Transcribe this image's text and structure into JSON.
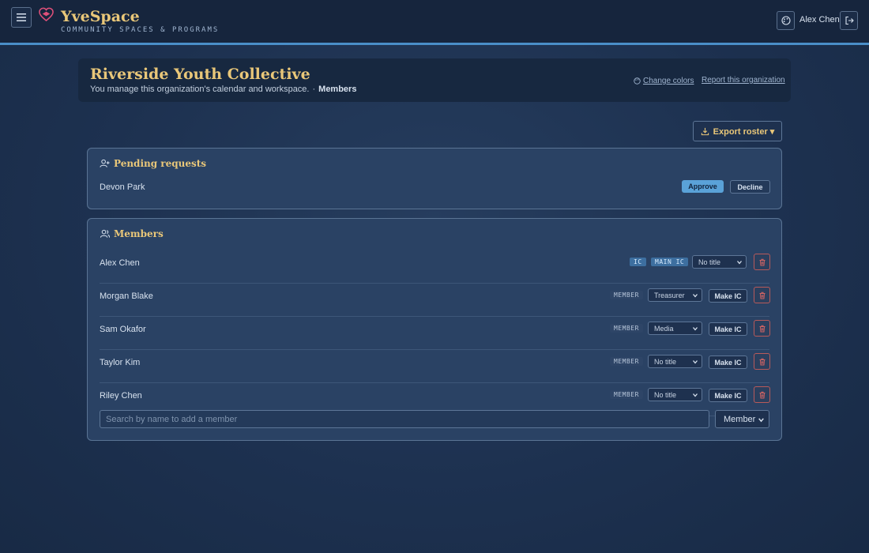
{
  "app": {
    "name": "YveSpace",
    "tagline": "COMMUNITY SPACES & PROGRAMS"
  },
  "user": {
    "name": "Alex Chen"
  },
  "org": {
    "title": "Riverside Youth Collective",
    "subtitle": "You manage this organization's calendar and workspace.",
    "separator": "·",
    "section": "Members",
    "change_colors": "Change colors",
    "report": "Report this organization"
  },
  "toolbar": {
    "export_label": "Export roster ▾"
  },
  "pending": {
    "title": "Pending requests",
    "requests": [
      {
        "name": "Devon Park",
        "approve": "Approve",
        "decline": "Decline"
      }
    ]
  },
  "members": {
    "title": "Members",
    "rows": [
      {
        "name": "Alex Chen",
        "badges": [
          "IC",
          "MAIN IC"
        ],
        "title": "No title"
      },
      {
        "name": "Morgan Blake",
        "role": "MEMBER",
        "title": "Treasurer",
        "make_ic": "Make IC"
      },
      {
        "name": "Sam Okafor",
        "role": "MEMBER",
        "title": "Media",
        "make_ic": "Make IC"
      },
      {
        "name": "Taylor Kim",
        "role": "MEMBER",
        "title": "No title",
        "make_ic": "Make IC"
      },
      {
        "name": "Riley Chen",
        "role": "MEMBER",
        "title": "No title",
        "make_ic": "Make IC"
      }
    ],
    "add": {
      "placeholder": "Search by name to add a member",
      "role": "Member"
    }
  },
  "colors": {
    "accent": "#e9c779",
    "primary": "#5aa2d8",
    "danger": "#d06464",
    "topbar_border": "#4a8ec8"
  }
}
